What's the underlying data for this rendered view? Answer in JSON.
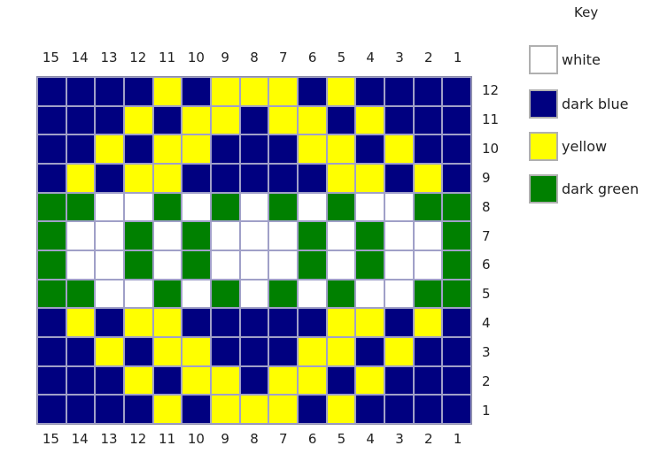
{
  "key": {
    "title": "Key",
    "items": [
      {
        "code": "W",
        "label": "white",
        "color": "#ffffff"
      },
      {
        "code": "B",
        "label": "dark blue",
        "color": "#000080"
      },
      {
        "code": "Y",
        "label": "yellow",
        "color": "#ffff00"
      },
      {
        "code": "G",
        "label": "dark green",
        "color": "#008000"
      }
    ]
  },
  "columns": [
    "15",
    "14",
    "13",
    "12",
    "11",
    "10",
    "9",
    "8",
    "7",
    "6",
    "5",
    "4",
    "3",
    "2",
    "1"
  ],
  "rows": [
    "12",
    "11",
    "10",
    "9",
    "8",
    "7",
    "6",
    "5",
    "4",
    "3",
    "2",
    "1"
  ],
  "pattern": [
    "BBBBYBYYYBYBBBB",
    "BBBYBYYBYYBYBBB",
    "BBYBYYBBBYYBYBB",
    "BYBYYBBBBBYYBYB",
    "GGWWGWGWGWGWWGG",
    "GWWGWGWWWGWGWWG",
    "GWWGWGWWWGWGWWG",
    "GGWWGWGWGWGWWGG",
    "BYBYYBBBBBYYBYB",
    "BBYBYYBBBYYBYBB",
    "BBBYBYYBYYBYBBB",
    "BBBBYBYYYBYBBBB"
  ]
}
